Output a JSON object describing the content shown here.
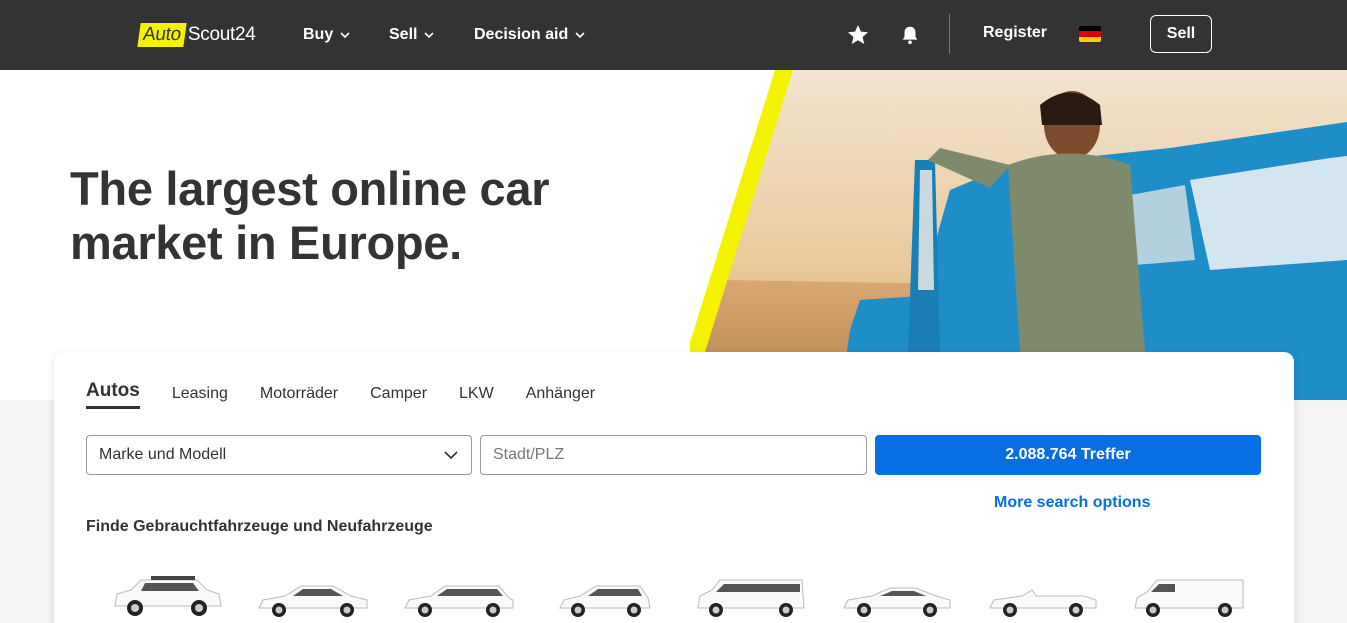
{
  "header": {
    "logo": {
      "part1": "Auto",
      "part2": "Scout24"
    },
    "nav": [
      {
        "label": "Buy"
      },
      {
        "label": "Sell"
      },
      {
        "label": "Decision aid"
      }
    ],
    "register_label": "Register",
    "sell_button_label": "Sell",
    "icons": [
      "star-icon",
      "bell-icon",
      "german-flag-icon"
    ]
  },
  "hero": {
    "title": "The largest online car market in Europe."
  },
  "search": {
    "tabs": [
      {
        "label": "Autos",
        "active": true
      },
      {
        "label": "Leasing"
      },
      {
        "label": "Motorräder"
      },
      {
        "label": "Camper"
      },
      {
        "label": "LKW"
      },
      {
        "label": "Anhänger"
      }
    ],
    "make_model_value": "Marke und Modell",
    "location_placeholder": "Stadt/PLZ",
    "results_button_label": "2.088.764 Treffer",
    "more_options_label": "More search options",
    "section_title": "Finde Gebrauchtfahrzeuge und Neufahrzeuge",
    "vehicle_types": [
      "suv-icon",
      "sedan-icon",
      "estate-icon",
      "hatchback-icon",
      "minibus-icon",
      "coupe-icon",
      "convertible-icon",
      "van-icon"
    ]
  },
  "colors": {
    "header_bg": "#333333",
    "brand_yellow": "#f5f200",
    "primary_blue": "#076ee3"
  }
}
